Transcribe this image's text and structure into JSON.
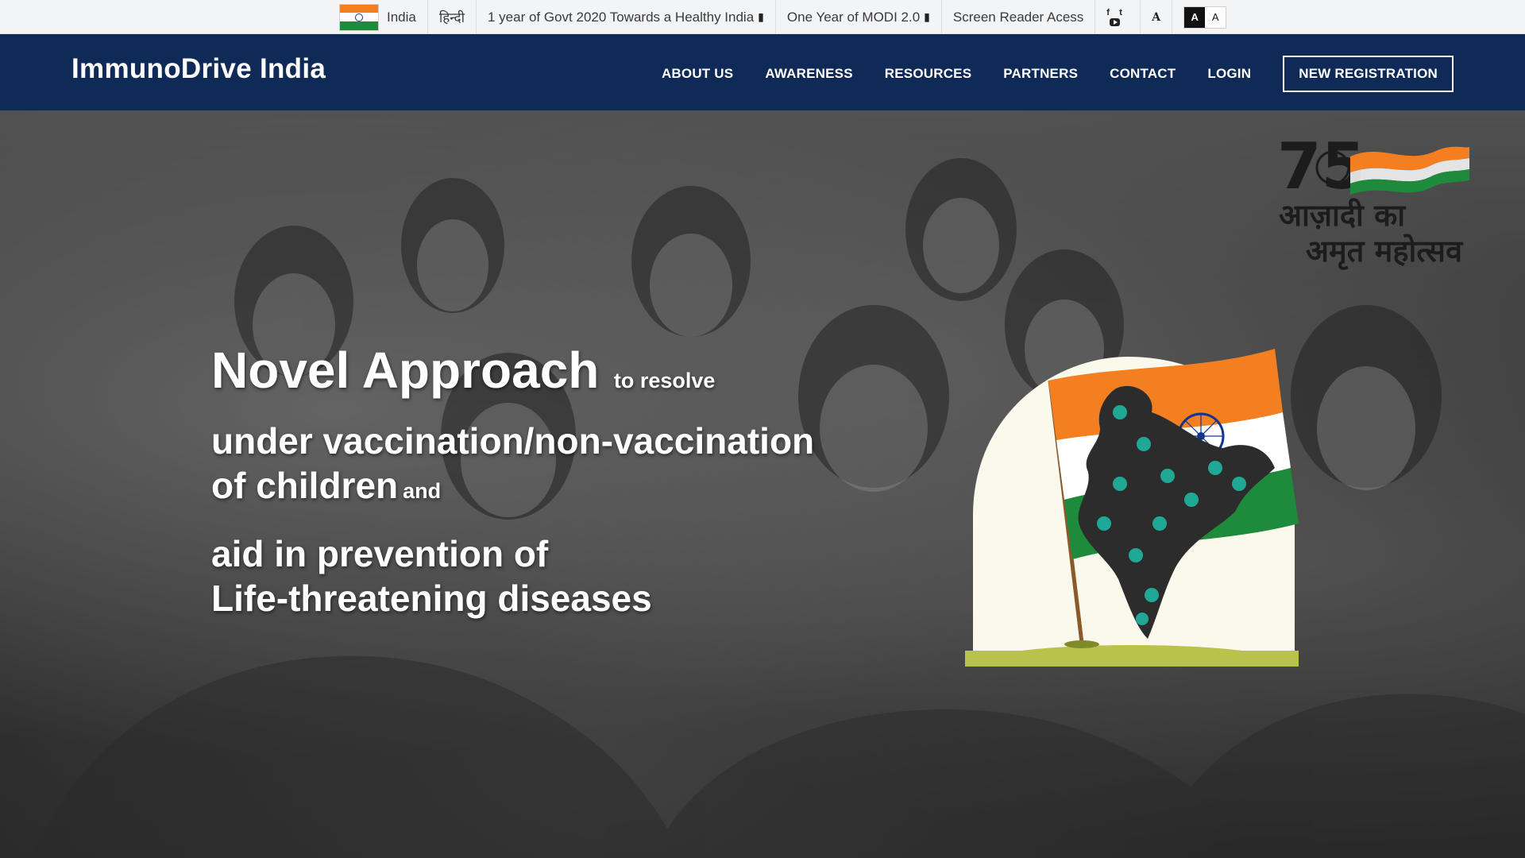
{
  "topbar": {
    "country": "India",
    "language": "हिन्दी",
    "link_healthy_india": "1 year of Govt 2020 Towards a Healthy India",
    "link_modi": "One Year of MODI 2.0",
    "screen_reader": "Screen Reader Acess",
    "social": {
      "facebook": "f",
      "twitter": "t"
    },
    "font_size_label": "A",
    "contrast": {
      "dark": "A",
      "light": "A"
    }
  },
  "header": {
    "brand": "ImmunoDrive India",
    "nav": {
      "about": "ABOUT US",
      "awareness": "AWARENESS",
      "resources": "RESOURCES",
      "partners": "PARTNERS",
      "contact": "CONTACT",
      "login": "LOGIN",
      "register": "NEW REGISTRATION"
    }
  },
  "hero": {
    "line1_big": "Novel Approach",
    "line1_small": "to resolve",
    "line2a": "under vaccination/non-vaccination",
    "line2b": "of children",
    "line2_small": "and",
    "line3a": "aid in prevention of",
    "line3b": "Life-threatening diseases",
    "logo": {
      "number": "75",
      "text1": "आज़ादी का",
      "text2": "अमृत महोत्सव"
    }
  },
  "colors": {
    "header_bg": "#0f2a56",
    "saffron": "#f47f20",
    "green": "#1e8a3c",
    "chakra": "#13348d",
    "teal": "#1fa896"
  }
}
